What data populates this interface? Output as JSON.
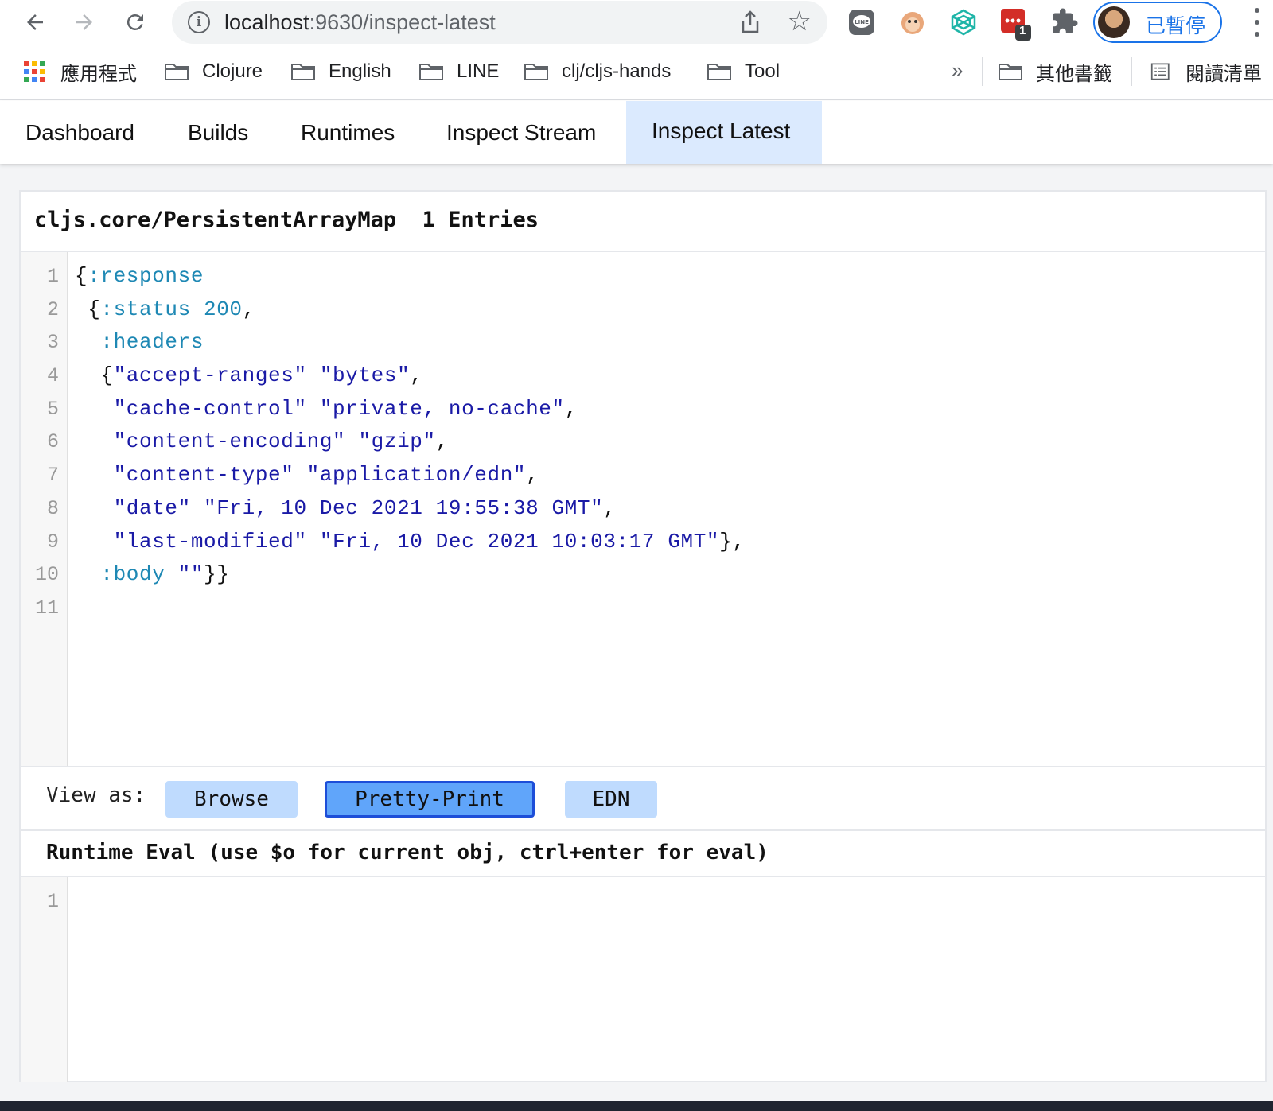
{
  "browser": {
    "url_host": "localhost",
    "url_path": ":9630/inspect-latest",
    "profile_label": "已暫停",
    "extension_badge": "1",
    "bookmarks": [
      {
        "label": "應用程式",
        "icon": "apps-grid-icon"
      },
      {
        "label": "Clojure",
        "icon": "folder-icon"
      },
      {
        "label": "English",
        "icon": "folder-icon"
      },
      {
        "label": "LINE",
        "icon": "folder-icon"
      },
      {
        "label": "clj/cljs-hands",
        "icon": "folder-icon"
      },
      {
        "label": "Tool",
        "icon": "folder-icon"
      }
    ],
    "overflow_label": "»",
    "other_bookmarks": "其他書籤",
    "reading_list": "閱讀清單"
  },
  "app_nav": {
    "tabs": [
      {
        "label": "Dashboard"
      },
      {
        "label": "Builds"
      },
      {
        "label": "Runtimes"
      },
      {
        "label": "Inspect Stream"
      },
      {
        "label": "Inspect Latest"
      }
    ],
    "active_tab": "Inspect Latest"
  },
  "inspector": {
    "type_name": "cljs.core/PersistentArrayMap",
    "entry_count": "1 Entries",
    "line_numbers": [
      "1",
      "2",
      "3",
      "4",
      "5",
      "6",
      "7",
      "8",
      "9",
      "10",
      "11"
    ],
    "code_lines": [
      [
        {
          "t": "p",
          "v": "{"
        },
        {
          "t": "kw",
          "v": ":response"
        }
      ],
      [
        {
          "t": "p",
          "v": " {"
        },
        {
          "t": "kw",
          "v": ":status"
        },
        {
          "t": "p",
          "v": " "
        },
        {
          "t": "num",
          "v": "200"
        },
        {
          "t": "p",
          "v": ","
        }
      ],
      [
        {
          "t": "p",
          "v": "  "
        },
        {
          "t": "kw",
          "v": ":headers"
        }
      ],
      [
        {
          "t": "p",
          "v": "  {"
        },
        {
          "t": "str",
          "v": "\"accept-ranges\""
        },
        {
          "t": "p",
          "v": " "
        },
        {
          "t": "str",
          "v": "\"bytes\""
        },
        {
          "t": "p",
          "v": ","
        }
      ],
      [
        {
          "t": "p",
          "v": "   "
        },
        {
          "t": "str",
          "v": "\"cache-control\""
        },
        {
          "t": "p",
          "v": " "
        },
        {
          "t": "str",
          "v": "\"private, no-cache\""
        },
        {
          "t": "p",
          "v": ","
        }
      ],
      [
        {
          "t": "p",
          "v": "   "
        },
        {
          "t": "str",
          "v": "\"content-encoding\""
        },
        {
          "t": "p",
          "v": " "
        },
        {
          "t": "str",
          "v": "\"gzip\""
        },
        {
          "t": "p",
          "v": ","
        }
      ],
      [
        {
          "t": "p",
          "v": "   "
        },
        {
          "t": "str",
          "v": "\"content-type\""
        },
        {
          "t": "p",
          "v": " "
        },
        {
          "t": "str",
          "v": "\"application/edn\""
        },
        {
          "t": "p",
          "v": ","
        }
      ],
      [
        {
          "t": "p",
          "v": "   "
        },
        {
          "t": "str",
          "v": "\"date\""
        },
        {
          "t": "p",
          "v": " "
        },
        {
          "t": "str",
          "v": "\"Fri, 10 Dec 2021 19:55:38 GMT\""
        },
        {
          "t": "p",
          "v": ","
        }
      ],
      [
        {
          "t": "p",
          "v": "   "
        },
        {
          "t": "str",
          "v": "\"last-modified\""
        },
        {
          "t": "p",
          "v": " "
        },
        {
          "t": "str",
          "v": "\"Fri, 10 Dec 2021 10:03:17 GMT\""
        },
        {
          "t": "p",
          "v": "},"
        }
      ],
      [
        {
          "t": "p",
          "v": "  "
        },
        {
          "t": "kw",
          "v": ":body"
        },
        {
          "t": "p",
          "v": " "
        },
        {
          "t": "str",
          "v": "\"\""
        },
        {
          "t": "p",
          "v": "}}"
        }
      ],
      []
    ],
    "view_as_label": "View as:",
    "view_modes": [
      {
        "label": "Browse"
      },
      {
        "label": "Pretty-Print"
      },
      {
        "label": "EDN"
      }
    ],
    "active_view_mode": "Pretty-Print",
    "eval_title": "Runtime Eval (use $o for current obj, ctrl+enter for eval)",
    "eval_line_numbers": [
      "1"
    ],
    "eval_value": ""
  },
  "colors": {
    "keyword": "#1e88b4",
    "string": "#1a1aa6",
    "active_tab_bg": "#dbeafe",
    "view_button_bg": "#bfdbfe",
    "view_button_active_bg": "#60a5fa",
    "view_button_active_border": "#1d4ed8",
    "profile_accent": "#1a73e8"
  }
}
